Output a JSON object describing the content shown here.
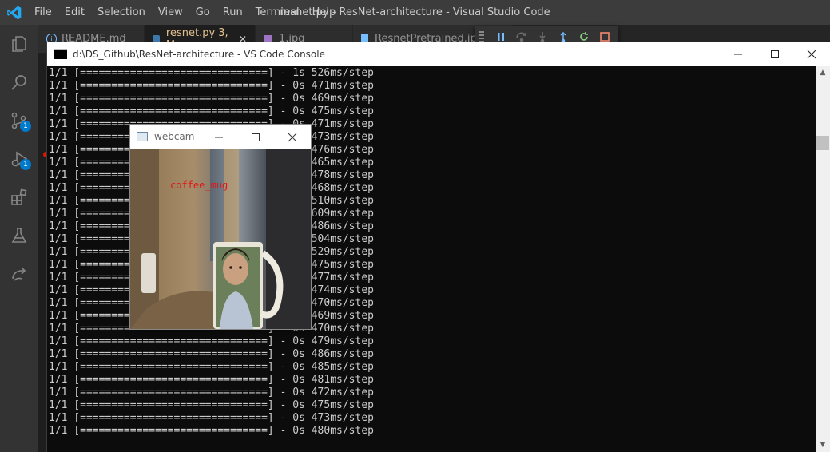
{
  "app": {
    "window_title": "resnet.py - ResNet-architecture - Visual Studio Code",
    "menu": [
      "File",
      "Edit",
      "Selection",
      "View",
      "Go",
      "Run",
      "Terminal",
      "Help"
    ]
  },
  "activity_bar": {
    "source_control_badge": "1",
    "run_debug_badge": "1"
  },
  "tabs": [
    {
      "label": "README.md",
      "icon": "info-icon"
    },
    {
      "label": "resnet.py  3, M",
      "icon": "python-icon",
      "active": true
    },
    {
      "label": "1.jpg",
      "icon": "image-icon"
    },
    {
      "label": "ResnetPretrained.ipynb",
      "icon": "notebook-icon"
    }
  ],
  "console": {
    "title": "d:\\DS_Github\\ResNet-architecture - VS Code Console",
    "lines": [
      "1/1 [==============================] - 1s 526ms/step",
      "1/1 [==============================] - 0s 471ms/step",
      "1/1 [==============================] - 0s 469ms/step",
      "1/1 [==============================] - 0s 475ms/step",
      "1/1 [==============================] - 0s 471ms/step",
      "1/1 [==============================] - 0s 473ms/step",
      "1/1 [==============================] - 0s 476ms/step",
      "1/1 [==============================] - 0s 465ms/step",
      "1/1 [==============================] - 0s 478ms/step",
      "1/1 [==============================] - 0s 468ms/step",
      "1/1 [==============================] - 0s 510ms/step",
      "1/1 [==============================] - 0s 609ms/step",
      "1/1 [==============================] - 0s 486ms/step",
      "1/1 [==============================] - 0s 504ms/step",
      "1/1 [==============================] - 0s 529ms/step",
      "1/1 [==============================] - 0s 475ms/step",
      "1/1 [==============================] - 0s 477ms/step",
      "1/1 [==============================] - 0s 474ms/step",
      "1/1 [==============================] - 0s 470ms/step",
      "1/1 [==============================] - 0s 469ms/step",
      "1/1 [==============================] - 0s 470ms/step",
      "1/1 [==============================] - 0s 479ms/step",
      "1/1 [==============================] - 0s 486ms/step",
      "1/1 [==============================] - 0s 485ms/step",
      "1/1 [==============================] - 0s 481ms/step",
      "1/1 [==============================] - 0s 472ms/step",
      "1/1 [==============================] - 0s 475ms/step",
      "1/1 [==============================] - 0s 473ms/step",
      "1/1 [==============================] - 0s 480ms/step"
    ]
  },
  "webcam": {
    "title": "webcam",
    "prediction": "coffee_mug"
  },
  "colors": {
    "accent": "#007acc",
    "active_tab_text": "#e2c08d",
    "prediction_text": "#e01818",
    "console_bg": "#0c0c0c"
  }
}
